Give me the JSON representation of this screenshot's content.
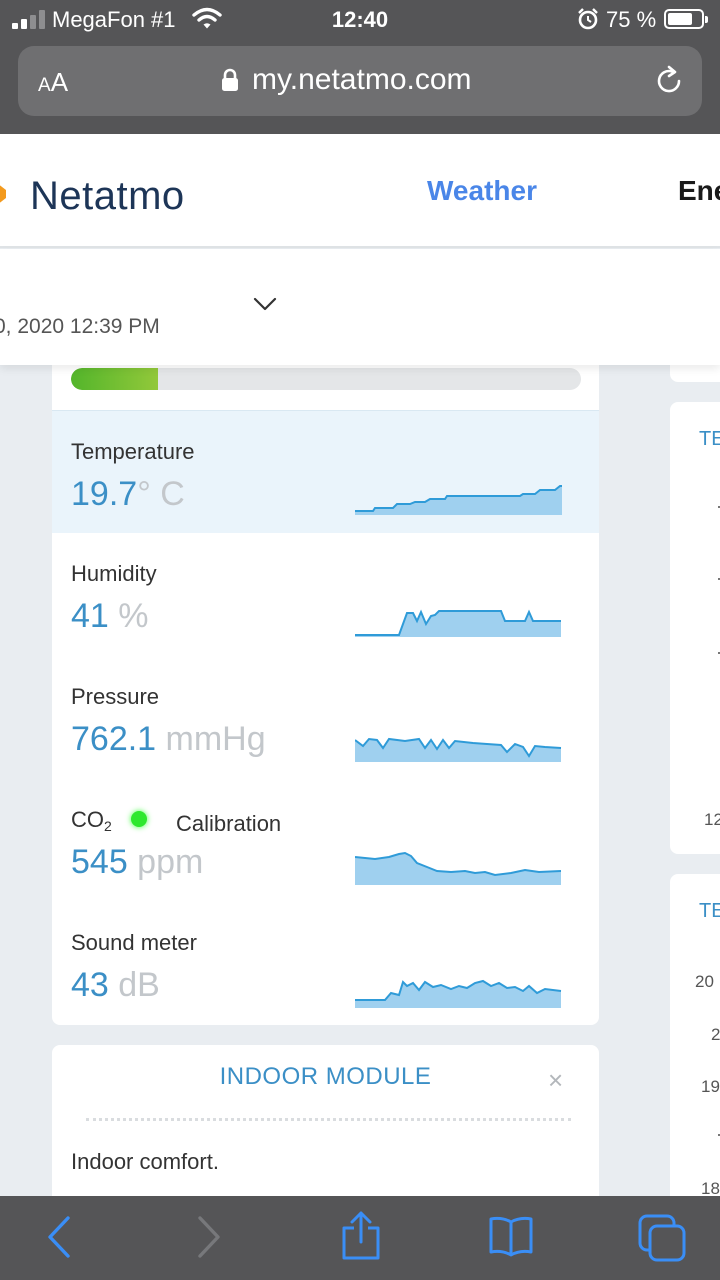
{
  "status_bar": {
    "carrier": "MegaFon #1",
    "time": "12:40",
    "battery_percent": "75 %",
    "battery_level": 0.75
  },
  "browser": {
    "text_size_label_small": "A",
    "text_size_label_large": "A",
    "url": "my.netatmo.com"
  },
  "site": {
    "logo": "Netatmo",
    "nav": {
      "weather": "Weather",
      "energy": "Ene"
    }
  },
  "date_bar": {
    "date_text": "0, 2020 12:39 PM"
  },
  "air_quality_progress": 0.17,
  "metrics": {
    "temperature": {
      "label": "Temperature",
      "value": "19.7",
      "unit": "° C"
    },
    "humidity": {
      "label": "Humidity",
      "value": "41",
      "unit": " %"
    },
    "pressure": {
      "label": "Pressure",
      "value": "762.1",
      "unit": " mmHg"
    },
    "co2": {
      "label_main": "CO",
      "label_sub": "2",
      "status": "Calibration",
      "value": "545",
      "unit": " ppm"
    },
    "sound": {
      "label": "Sound meter",
      "value": "43",
      "unit": " dB"
    }
  },
  "indoor_module": {
    "title": "INDOOR MODULE",
    "close": "×",
    "text": "Indoor comfort."
  },
  "right_panel": {
    "card1_label": "TE",
    "card1_num": "12",
    "card2_label": "TE",
    "card2_nums": [
      "20",
      "2",
      "19",
      "18"
    ]
  },
  "colors": {
    "accent": "#3b8fc6",
    "nav_active": "#4a86e8",
    "progress": "#62b92f",
    "co2_status": "#2ee82e"
  }
}
